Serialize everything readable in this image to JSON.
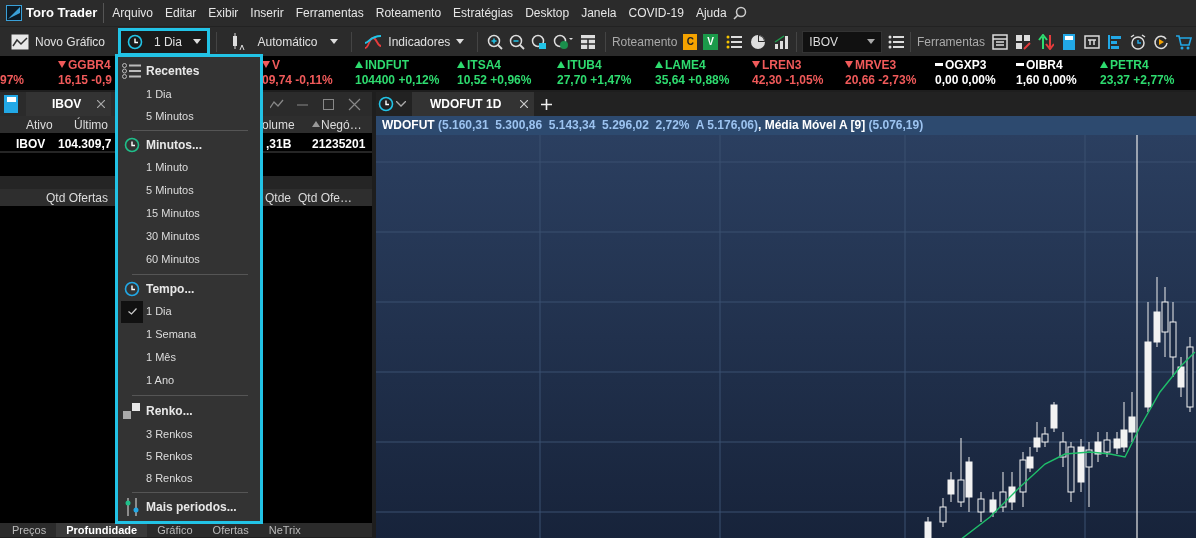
{
  "app": {
    "title": "Toro Trader"
  },
  "menu": [
    "Arquivo",
    "Editar",
    "Exibir",
    "Inserir",
    "Ferramentas",
    "Roteamento",
    "Estratégias",
    "Desktop",
    "Janela",
    "COVID-19",
    "Ajuda"
  ],
  "toolbar": {
    "new_chart": "Novo Gráfico",
    "period": {
      "value": "1 Dia",
      "expanded": true
    },
    "chart_type": "Automático",
    "indicators": "Indicadores",
    "routing_label": "Roteamento",
    "buy": "C",
    "sell": "V",
    "symbol": "IBOV",
    "tools_label": "Ferramentas"
  },
  "ticker": [
    {
      "value": "97%",
      "kind": "down"
    },
    {
      "name": "GGBR4",
      "value": "16,15 -0,9",
      "kind": "down"
    },
    {
      "name": "V",
      "value": "09,74 -0,11%",
      "kind": "down"
    },
    {
      "name": "INDFUT",
      "value": "104400 +0,12%",
      "kind": "up"
    },
    {
      "name": "ITSA4",
      "value": "10,52 +0,96%",
      "kind": "up"
    },
    {
      "name": "ITUB4",
      "value": "27,70 +1,47%",
      "kind": "up"
    },
    {
      "name": "LAME4",
      "value": "35,64 +0,88%",
      "kind": "up"
    },
    {
      "name": "LREN3",
      "value": "42,30 -1,05%",
      "kind": "down"
    },
    {
      "name": "MRVE3",
      "value": "20,66 -2,73%",
      "kind": "down"
    },
    {
      "name": "OGXP3",
      "value": "0,00 0,00%",
      "kind": "flat"
    },
    {
      "name": "OIBR4",
      "value": "1,60 0,00%",
      "kind": "flat"
    },
    {
      "name": "PETR4",
      "value": "23,37 +2,77%",
      "kind": "up"
    }
  ],
  "book_panel": {
    "tab": "IBOV",
    "columns": [
      "Ativo",
      "Último",
      "olume",
      "Negó…"
    ],
    "rows": [
      [
        "IBOV",
        "104.309,7",
        ",31B",
        "21235201"
      ]
    ],
    "depth_columns": [
      "Qtd Ofertas",
      "Qtde",
      "Qtd Ofe…"
    ],
    "bottom_tabs": [
      {
        "label": "Preços",
        "selected": false
      },
      {
        "label": "Profundidade",
        "selected": true
      },
      {
        "label": "Gráfico",
        "selected": false
      },
      {
        "label": "Ofertas",
        "selected": false
      },
      {
        "label": "NeTrix",
        "selected": false
      }
    ]
  },
  "chart": {
    "tab": "WDOFUT 1D",
    "legend": "**WDOFUT** (5.160,31  5.300,86  5.143,34  5.296,02  2,72%  A 5.176,06)**, Média Móvel A [9]** (5.076,19)"
  },
  "period_menu": {
    "sections": [
      {
        "title": "Recentes",
        "items": [
          {
            "label": "1 Dia",
            "checked": false
          },
          {
            "label": "5 Minutos",
            "checked": false
          }
        ]
      },
      {
        "title": "Minutos...",
        "items": [
          {
            "label": "1 Minuto",
            "checked": false
          },
          {
            "label": "5 Minutos",
            "checked": false
          },
          {
            "label": "15 Minutos",
            "checked": false
          },
          {
            "label": "30 Minutos",
            "checked": false
          },
          {
            "label": "60 Minutos",
            "checked": false
          }
        ]
      },
      {
        "title": "Tempo...",
        "items": [
          {
            "label": "1 Dia",
            "checked": true
          },
          {
            "label": "1 Semana",
            "checked": false
          },
          {
            "label": "1 Mês",
            "checked": false
          },
          {
            "label": "1 Ano",
            "checked": false
          }
        ]
      },
      {
        "title": "Renko...",
        "items": [
          {
            "label": "3 Renkos",
            "checked": false
          },
          {
            "label": "5 Renkos",
            "checked": false
          },
          {
            "label": "8 Renkos",
            "checked": false
          }
        ]
      },
      {
        "title": "Mais periodos..."
      }
    ]
  }
}
